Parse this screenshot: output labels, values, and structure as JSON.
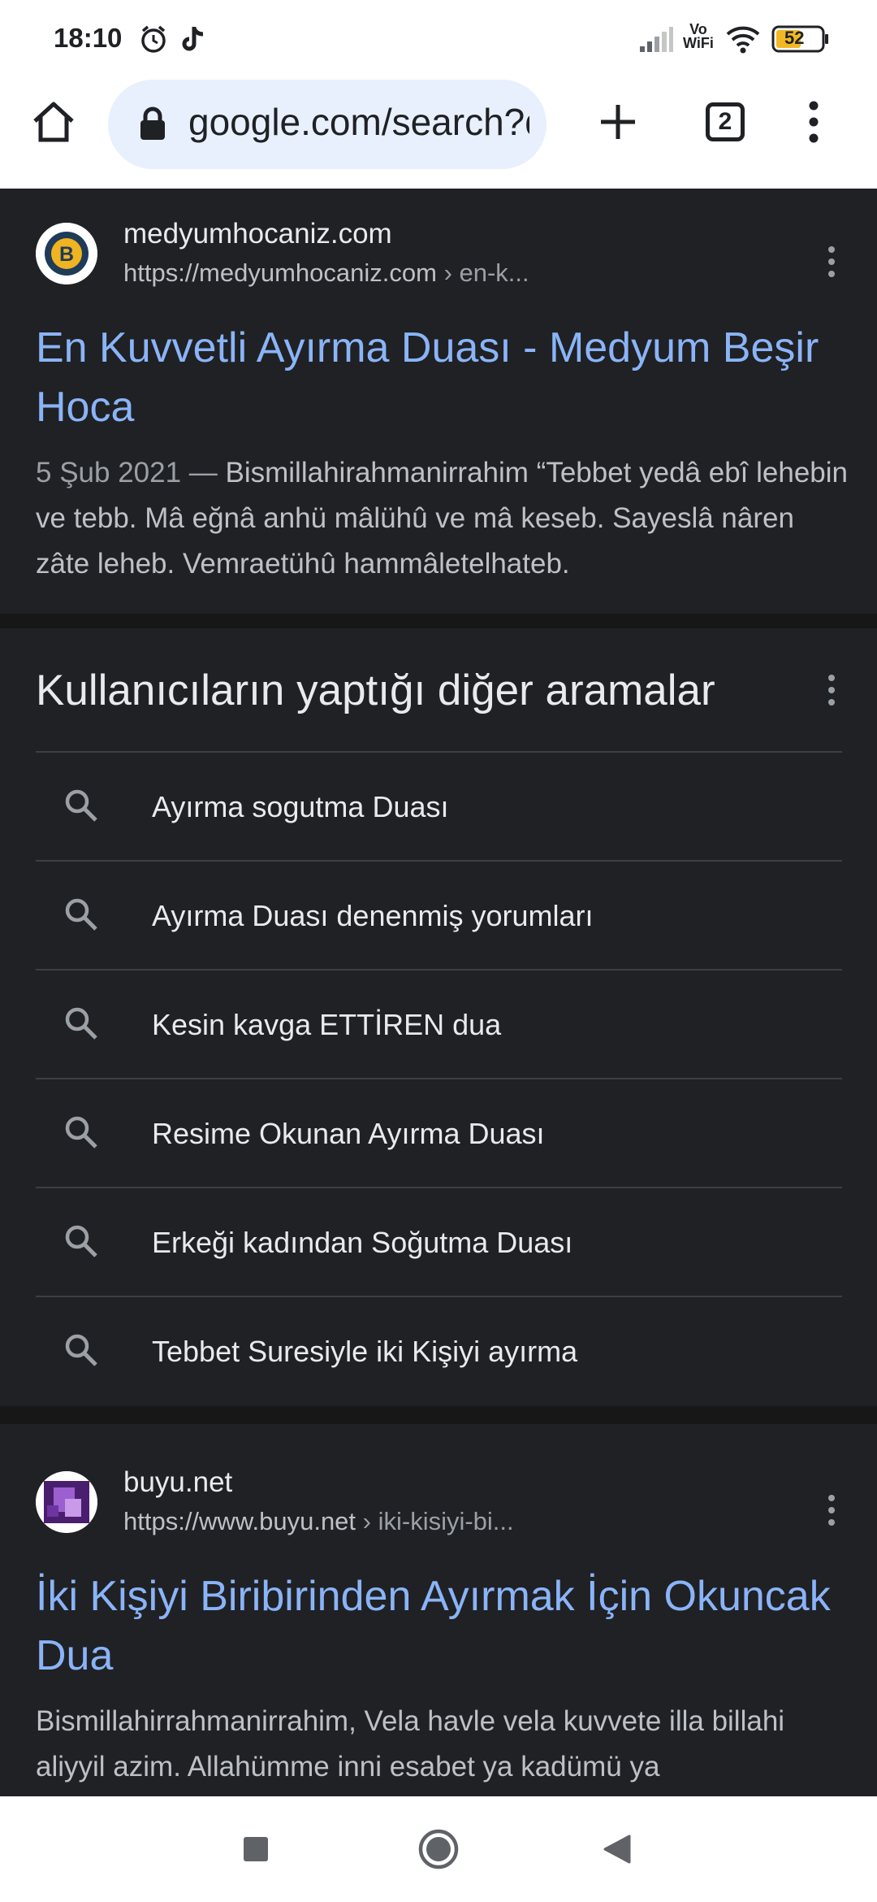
{
  "status_bar": {
    "time": "18:10",
    "battery": "52",
    "network_label_top": "Vo",
    "network_label_bottom": "WiFi"
  },
  "toolbar": {
    "url": "google.com/search?q",
    "tab_count": "2"
  },
  "results": [
    {
      "site_name": "medyumhocaniz.com",
      "url_base": "https://medyumhocaniz.com",
      "url_path": " › en-k...",
      "title": "En Kuvvetli Ayırma Duası - Medyum Beşir Hoca",
      "date": "5 Şub 2021 —",
      "snippet": " Bismillahirahmanirrahim “Tebbet yedâ ebî lehebin ve tebb. Mâ eğnâ anhü mâlühû ve mâ keseb. Sayeslâ nâren zâte leheb. Vemraetühû hammâletelhateb."
    },
    {
      "site_name": "buyu.net",
      "url_base": "https://www.buyu.net",
      "url_path": " › iki-kisiyi-bi...",
      "title": "İki Kişiyi Biribirinden Ayırmak İçin Okuncak Dua",
      "snippet": "Bismillahirrahmanirrahim, Vela havle vela kuvvete illa billahi aliyyil azim. Allahümme inni esabet ya kadümü ya"
    }
  ],
  "related": {
    "heading": "Kullanıcıların yaptığı diğer aramalar",
    "items": [
      "Ayırma sogutma Duası",
      "Ayırma Duası denenmiş yorumları",
      "Kesin kavga ETTİREN dua",
      "Resime Okunan Ayırma Duası",
      "Erkeği kadından Soğutma Duası",
      "Tebbet Suresiyle iki Kişiyi ayırma"
    ]
  },
  "colors": {
    "background": "#202124",
    "link": "#8ab4f8",
    "text": "#e8eaed",
    "secondary": "#bdc1c6"
  }
}
